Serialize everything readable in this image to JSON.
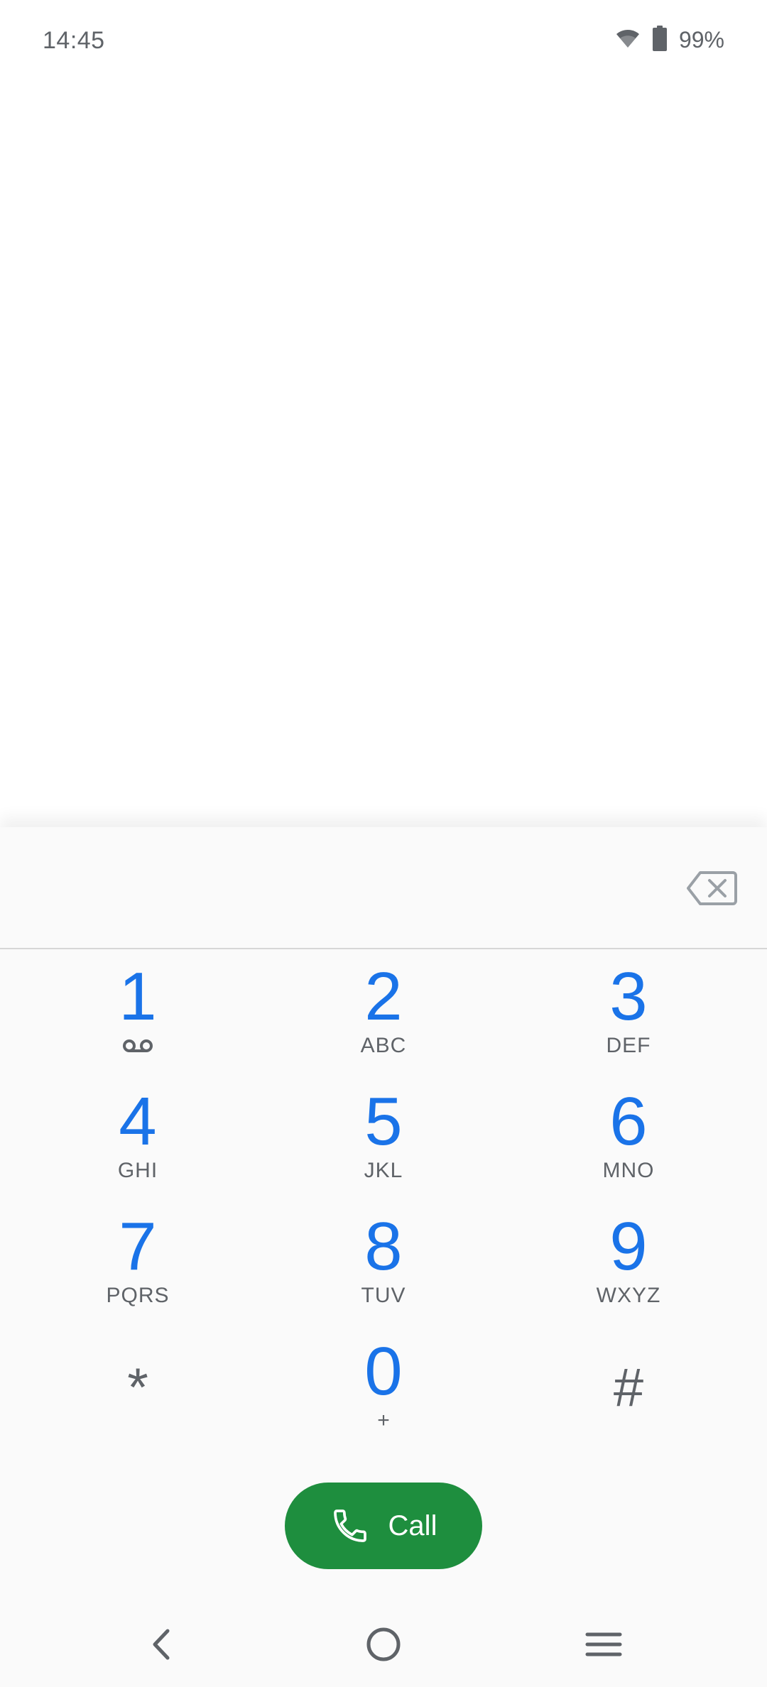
{
  "status_bar": {
    "time": "14:45",
    "battery_percent": "99%",
    "icons": [
      "wifi-icon",
      "battery-icon"
    ]
  },
  "dialer": {
    "digits_value": "",
    "backspace_icon": "backspace-icon",
    "keys": [
      {
        "digit": "1",
        "letters": "",
        "sub_icon": "voicemail-icon"
      },
      {
        "digit": "2",
        "letters": "ABC"
      },
      {
        "digit": "3",
        "letters": "DEF"
      },
      {
        "digit": "4",
        "letters": "GHI"
      },
      {
        "digit": "5",
        "letters": "JKL"
      },
      {
        "digit": "6",
        "letters": "MNO"
      },
      {
        "digit": "7",
        "letters": "PQRS"
      },
      {
        "digit": "8",
        "letters": "TUV"
      },
      {
        "digit": "9",
        "letters": "WXYZ"
      },
      {
        "digit": "*",
        "letters": ""
      },
      {
        "digit": "0",
        "letters": "+"
      },
      {
        "digit": "#",
        "letters": ""
      }
    ],
    "call_label": "Call",
    "call_icon": "phone-icon"
  },
  "nav_bar": {
    "icons": [
      "back-icon",
      "home-icon",
      "menu-icon"
    ]
  },
  "colors": {
    "digit": "#1a73e8",
    "call_button": "#1e8e3e",
    "secondary_text": "#5f6368"
  }
}
